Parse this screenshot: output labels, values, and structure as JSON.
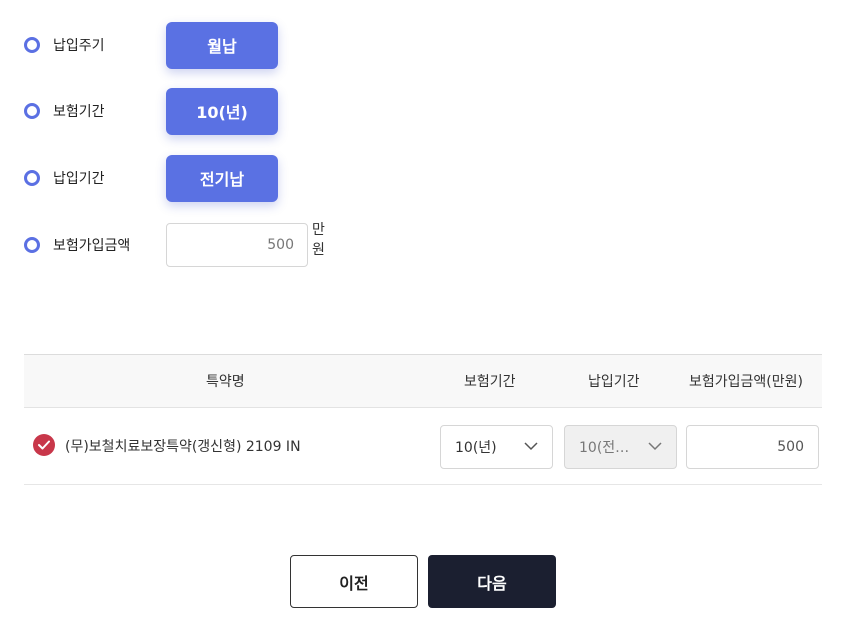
{
  "options": [
    {
      "label": "납입주기",
      "value": "월납"
    },
    {
      "label": "보험기간",
      "value": "10(년)"
    },
    {
      "label": "납입기간",
      "value": "전기납"
    }
  ],
  "amount": {
    "label": "보험가입금액",
    "value": "500",
    "unit": "만원"
  },
  "table": {
    "headers": [
      "특약명",
      "보험기간",
      "납입기간",
      "보험가입금액(만원)"
    ],
    "rows": [
      {
        "checked": true,
        "name": "(무)보철치료보장특약(갱신형) 2109 IN",
        "insurance_period": "10(년)",
        "payment_period": "10(전…",
        "amount": "500"
      }
    ]
  },
  "buttons": {
    "prev": "이전",
    "next": "다음"
  },
  "colors": {
    "accent": "#5a71e3",
    "check": "#c8374a",
    "next_bg": "#1b1f30"
  }
}
